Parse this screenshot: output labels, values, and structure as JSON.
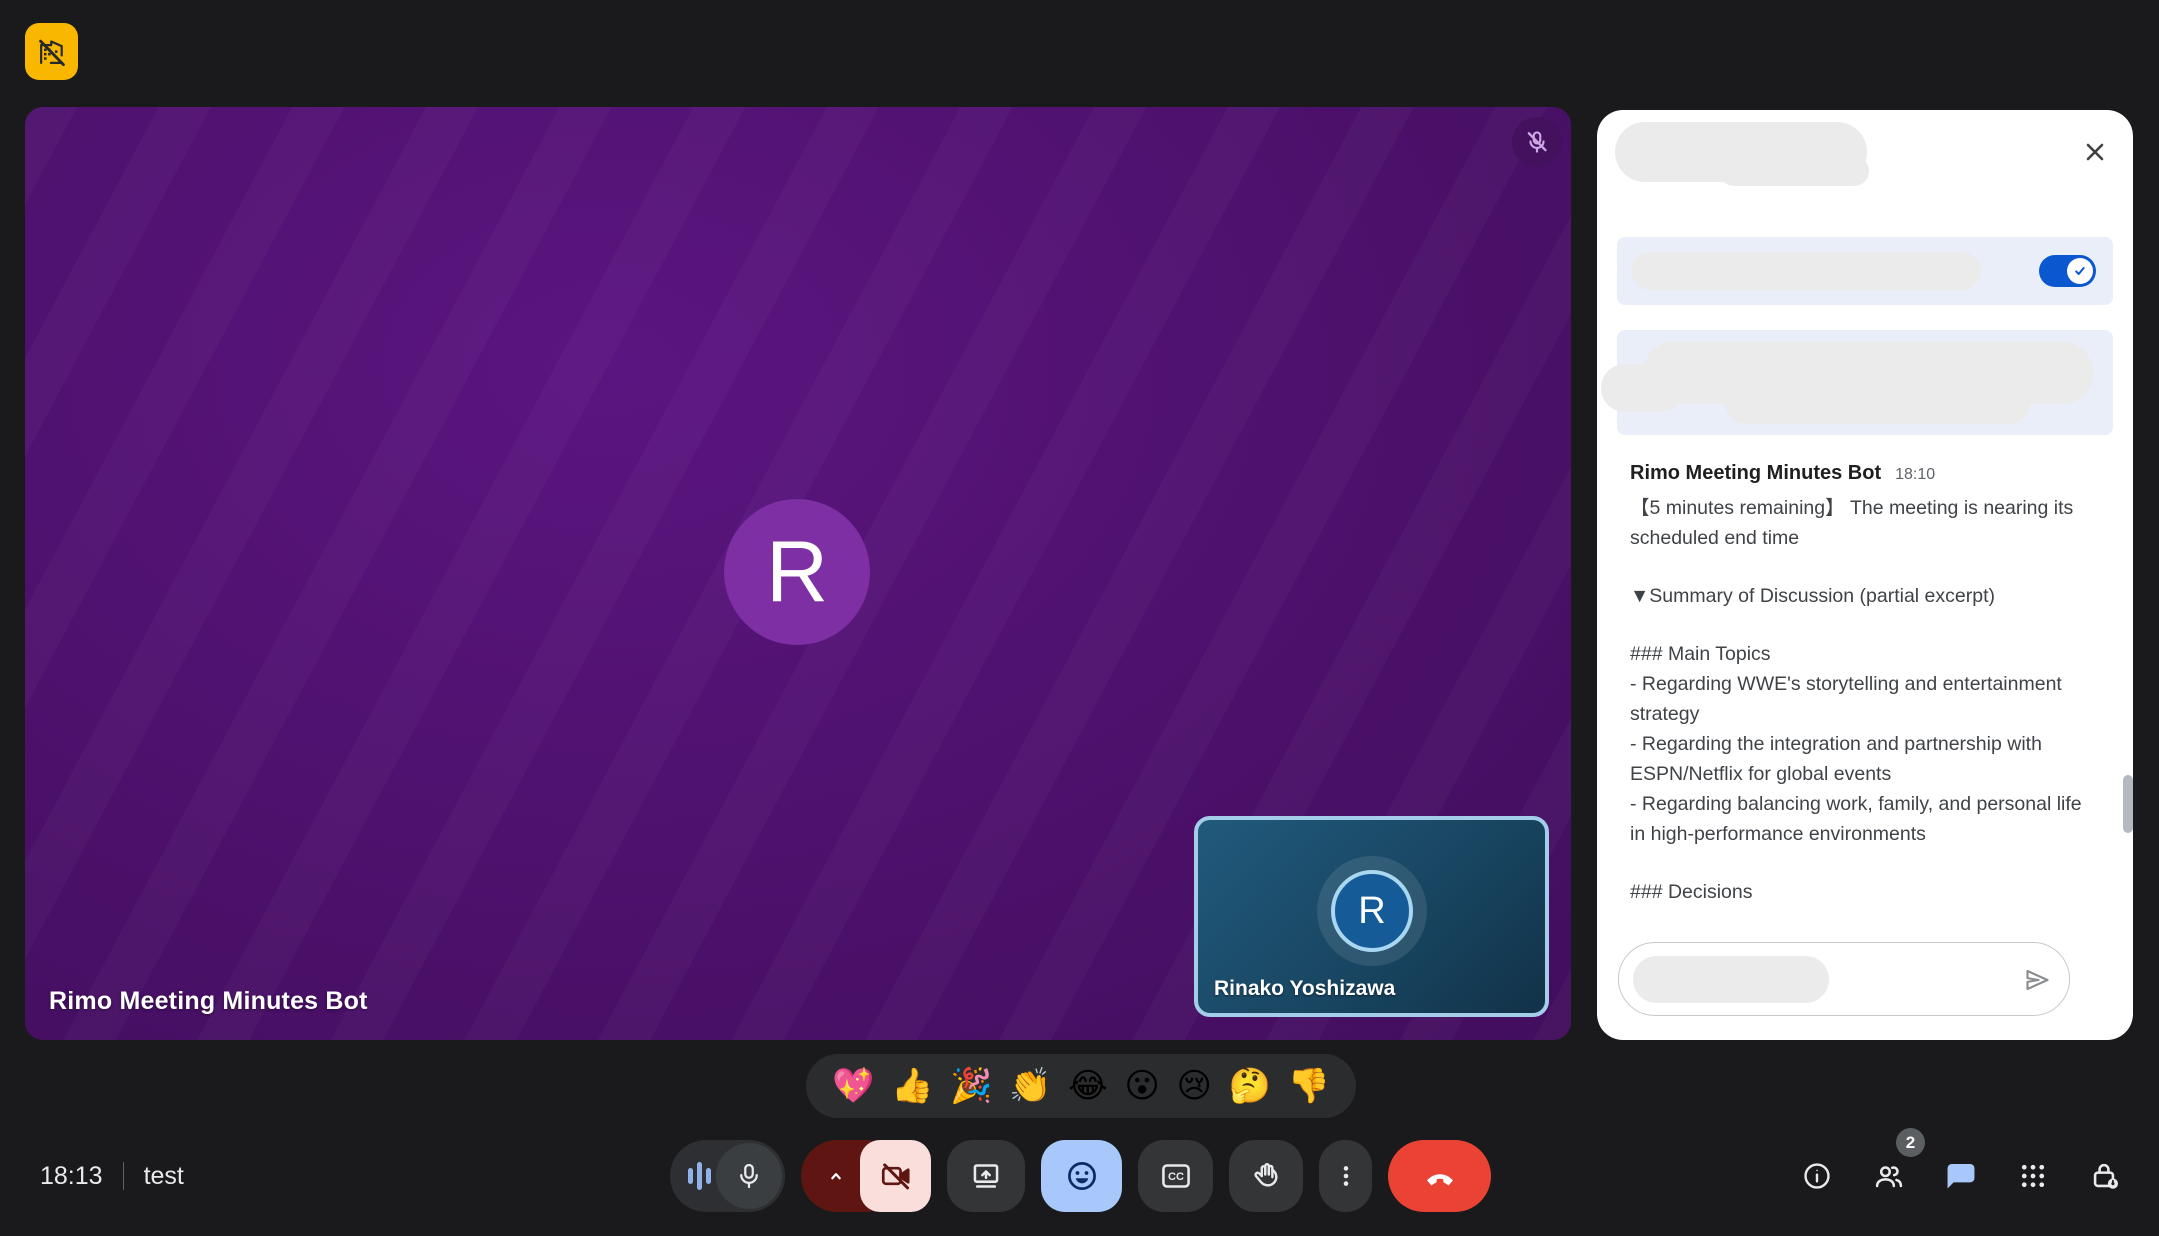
{
  "window": {
    "clock": "18:13",
    "meeting_name": "test"
  },
  "companion_tile": {
    "yellow": "#f9b700"
  },
  "stage": {
    "participant_name": "Rimo Meeting Minutes Bot",
    "avatar_letter": "R",
    "mic_muted": true,
    "bg_purple": "#4a1068",
    "avatar_purple": "#7d2fa3"
  },
  "pip": {
    "participant_name": "Rinako Yoshizawa",
    "avatar_letter": "R",
    "border_blue": "#a4cde9",
    "avatar_blue": "#155b97"
  },
  "chat_panel": {
    "toggle_on": true,
    "accent_blue": "#0b57d0",
    "message": {
      "sender": "Rimo Meeting Minutes Bot",
      "time": "18:10",
      "paragraphs": [
        "【5 minutes remaining】 The meeting is nearing its scheduled end time",
        "▼Summary of Discussion (partial excerpt)",
        "### Main Topics\n- Regarding WWE's storytelling and entertainment strategy\n- Regarding the integration and partnership with ESPN/Netflix for global events\n- Regarding balancing work, family, and personal life in high-performance environments",
        "### Decisions"
      ]
    }
  },
  "reactions": [
    "💖",
    "👍",
    "🎉",
    "👏",
    "😂",
    "😮",
    "😢",
    "🤔",
    "👎"
  ],
  "toolbar": {
    "end_call_red": "#ea4335",
    "camera_off_pink": "#f9dedc",
    "camera_off_dark_red": "#5f1511",
    "reactions_active_blue": "#a8c7fa",
    "cc_label": "CC"
  },
  "right_toolbar": {
    "participants_badge": "2",
    "chat_active_blue": "#a8c7fa"
  }
}
